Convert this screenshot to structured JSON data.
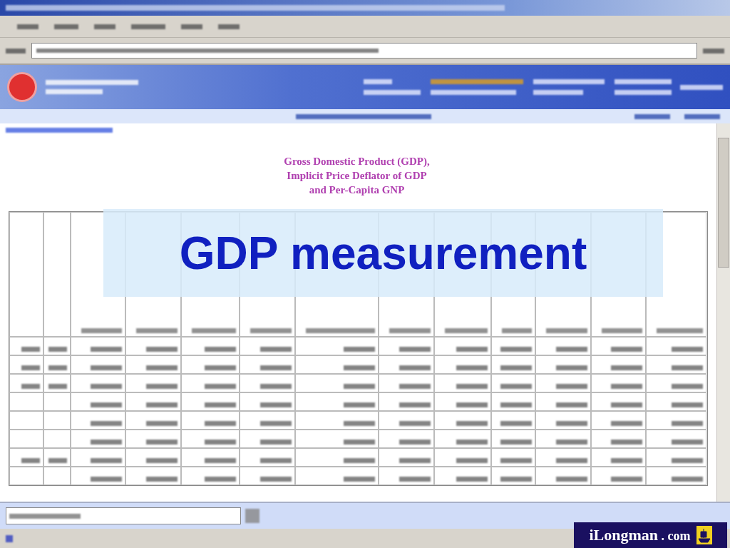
{
  "page": {
    "title_lines": [
      "Gross Domestic Product (GDP),",
      "Implicit Price Deflator of GDP",
      "and Per-Capita GNP"
    ]
  },
  "slide": {
    "title": "GDP measurement",
    "logo": {
      "name": "iLongman",
      "suffix": ". com"
    }
  }
}
